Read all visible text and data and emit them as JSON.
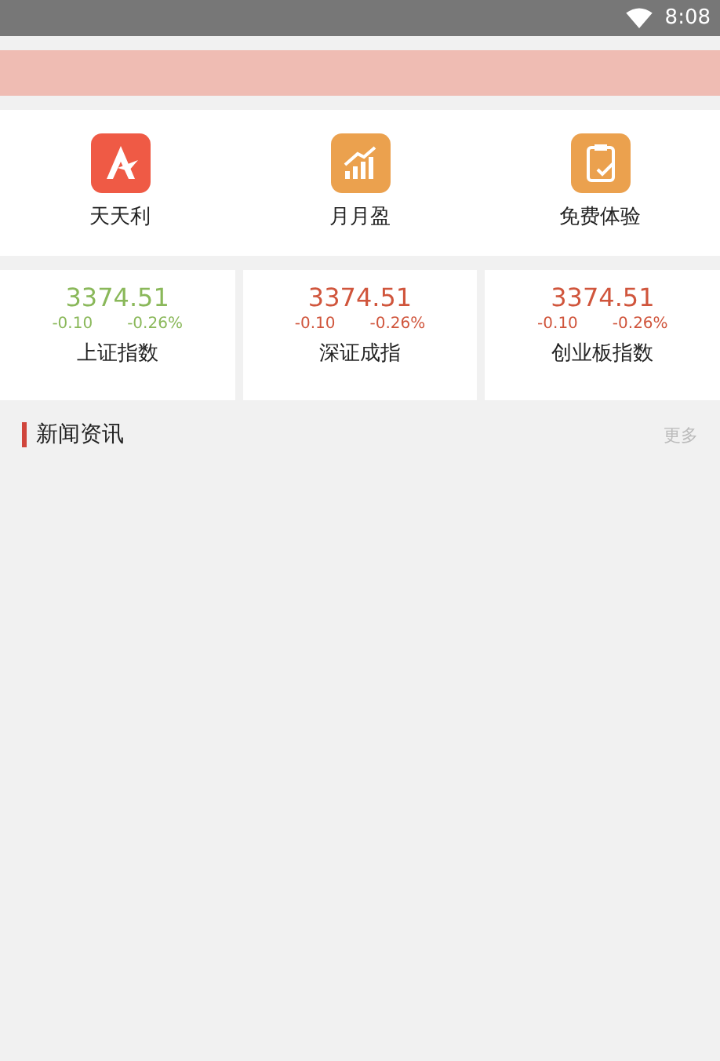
{
  "status_bar": {
    "time": "8:08"
  },
  "shortcuts": [
    {
      "label": "天天利",
      "kind": "star"
    },
    {
      "label": "月月盈",
      "kind": "chart"
    },
    {
      "label": "免费体验",
      "kind": "clipboard"
    }
  ],
  "indices": [
    {
      "value": "3374.51",
      "change": "-0.10",
      "percent": "-0.26%",
      "name": "上证指数",
      "color": "#8ab85a"
    },
    {
      "value": "3374.51",
      "change": "-0.10",
      "percent": "-0.26%",
      "name": "深证成指",
      "color": "#d0553c"
    },
    {
      "value": "3374.51",
      "change": "-0.10",
      "percent": "-0.26%",
      "name": "创业板指数",
      "color": "#d0553c"
    }
  ],
  "news": {
    "title": "新闻资讯",
    "more": "更多"
  }
}
